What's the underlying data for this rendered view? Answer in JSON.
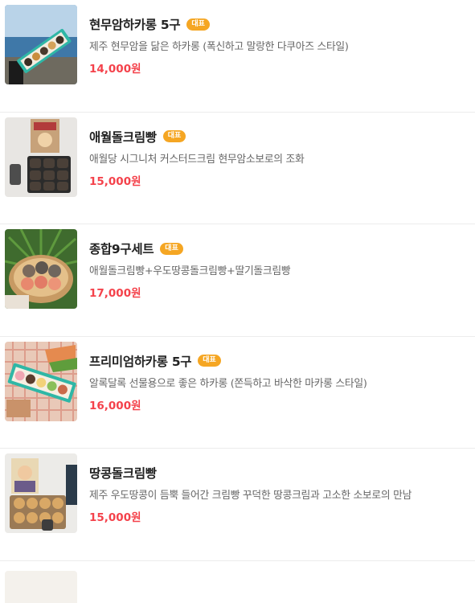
{
  "items": [
    {
      "name": "현무암하카롱 5구",
      "badge": "대표",
      "description": "제주 현무암을 닮은 하카롱 (폭신하고 말랑한 다쿠아즈 스타일)",
      "price": "14,000원",
      "image_icon": "product-photo"
    },
    {
      "name": "애월돌크림빵",
      "badge": "대표",
      "description": "애월당 시그니처 커스터드크림 현무암소보로의 조화",
      "price": "15,000원",
      "image_icon": "product-photo"
    },
    {
      "name": "종합9구세트",
      "badge": "대표",
      "description": "애월돌크림빵+우도땅콩돌크림빵+딸기돌크림빵",
      "price": "17,000원",
      "image_icon": "product-photo"
    },
    {
      "name": "프리미엄하카롱 5구",
      "badge": "대표",
      "description": "알록달록 선물용으로 좋은 하카롱 (쫀득하고 바삭한 마카롱 스타일)",
      "price": "16,000원",
      "image_icon": "product-photo"
    },
    {
      "name": "땅콩돌크림빵",
      "badge": "",
      "description": "제주 우도땅콩이 듬뿍 들어간 크림빵 꾸덕한 땅콩크림과 고소한 소보로의 만남",
      "price": "15,000원",
      "image_icon": "product-photo"
    }
  ],
  "colors": {
    "badge": "#f5a623",
    "price": "#f4424b",
    "divider": "#ececec"
  }
}
